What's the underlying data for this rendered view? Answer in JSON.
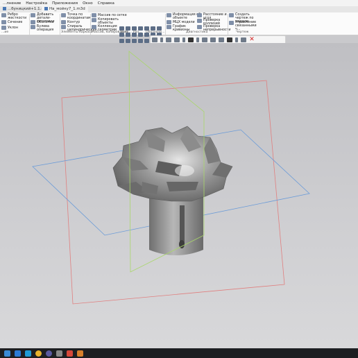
{
  "menubar": {
    "items": [
      "...лнение",
      "Настройка",
      "Приложения",
      "Окно",
      "Справка"
    ]
  },
  "tabs": [
    {
      "label": "...буницкий+1.1.m3d"
    },
    {
      "label": "На_мойку7_1.m3d"
    }
  ],
  "ribbon": {
    "buttons": {
      "rebro": "Ребро жесткости",
      "sechenie": "Сечение",
      "uklon": "Уклон",
      "dobavit": "Добавить детали-заготовки",
      "obolochka": "Оболочка",
      "bulevaya": "Булева операция",
      "tochka": "Точка по координатам",
      "kontur": "Контур",
      "spiral": "Спираль цилиндрическая...",
      "massiv": "Массив по сетке",
      "kopirovat": "Копировать объекты",
      "kollekciya": "Коллекция геометрии",
      "info": "Информация об объекте",
      "mcx": "МЦХ модели",
      "grafik": "График кривизны",
      "rasstoyanie": "Расстояние и угол",
      "proverka_kollizii": "Проверка коллизий",
      "proverka_nepreryvnosti": "Проверка непрерывности",
      "sozdat_chertezh": "Создать чертеж по модели",
      "upravlenie": "Управление связанными ч..."
    },
    "groups": {
      "g1": "...ие",
      "g2": "Элементы каркаса",
      "g3": "Массив, копирование",
      "g4": "Вспо...",
      "g5": "Раз...",
      "g6": "Обозначе...",
      "g7": "Диагностика",
      "g8": "Чертеж"
    }
  },
  "viewport_toolbar": {
    "icons": [
      "zoom-icon",
      "dropdown-icon",
      "zoom-to-fit-icon",
      "orientation-icon",
      "dropdown-icon",
      "display-style-icon",
      "dropdown-icon",
      "shading-icon",
      "section-view-icon",
      "grid-icon",
      "filter-icon",
      "dropdown-icon",
      "pin-icon",
      "close-icon"
    ]
  },
  "viewport": {
    "colors": {
      "plane_xy": "#6a9bd8",
      "plane_zx": "#e07f7f",
      "plane_zy": "#a9d76a",
      "part_body": "#9a9a9a"
    }
  },
  "taskbar": {
    "icons": [
      "windows-icon",
      "search-icon",
      "edge-icon",
      "chrome-icon",
      "app-icon",
      "media-icon",
      "kompas-icon",
      "shield-icon"
    ],
    "colors": [
      "#3a8bd6",
      "#2b7bd6",
      "#1e9ad6",
      "#e8b32e",
      "#5a5aa0",
      "#888",
      "#d6483a",
      "#d67f2b"
    ]
  }
}
